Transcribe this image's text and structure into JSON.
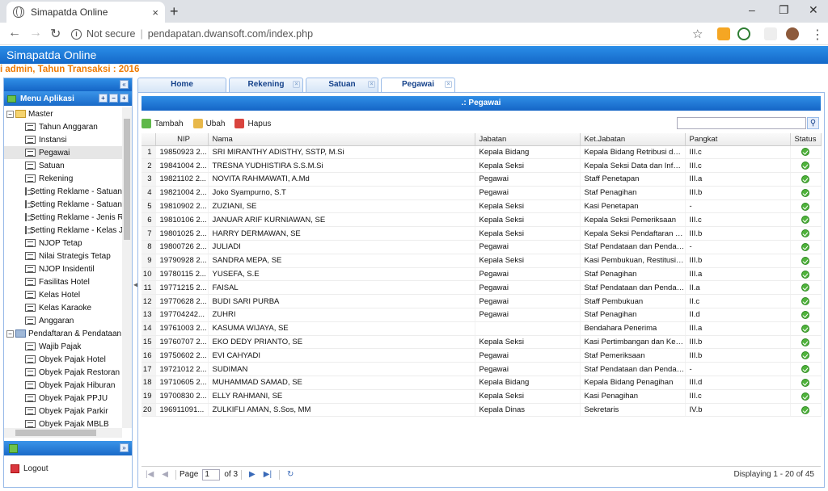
{
  "browser": {
    "tab_title": "Simapatda Online",
    "close_glyph": "×",
    "new_tab_glyph": "+",
    "omnibox_status": "Not secure",
    "omnibox_sep": "|",
    "url": "pendapatan.dwansoft.com/index.php",
    "star_glyph": "☆",
    "menu_glyph": "⋮"
  },
  "app": {
    "title": "Simapatda Online",
    "user_line": "i admin, Tahun Transaksi : 2016"
  },
  "sidebar": {
    "header": "Menu Aplikasi",
    "groups": [
      {
        "label": "Master"
      },
      {
        "label": "Pendaftaran & Pendataan"
      }
    ],
    "master_items": [
      "Tahun Anggaran",
      "Instansi",
      "Pegawai",
      "Satuan",
      "Rekening",
      "Setting Reklame - Satuan L",
      "Setting Reklame - Satuan T",
      "Setting Reklame - Jenis Re",
      "Setting Reklame - Kelas Ja",
      "NJOP Tetap",
      "Nilai Strategis Tetap",
      "NJOP Insidentil",
      "Fasilitas Hotel",
      "Kelas Hotel",
      "Kelas Karaoke",
      "Anggaran"
    ],
    "pendaftaran_items": [
      "Wajib Pajak",
      "Obyek Pajak Hotel",
      "Obyek Pajak Restoran",
      "Obyek Pajak Hiburan",
      "Obyek Pajak PPJU",
      "Obyek Pajak Parkir",
      "Obyek Pajak MBLB"
    ],
    "logout": "Logout"
  },
  "tabs": [
    "Home",
    "Rekening",
    "Satuan",
    "Pegawai"
  ],
  "grid": {
    "title": ".: Pegawai",
    "toolbar": {
      "add": "Tambah",
      "edit": "Ubah",
      "delete": "Hapus"
    },
    "columns": [
      "NIP",
      "Nama",
      "Jabatan",
      "Ket.Jabatan",
      "Pangkat",
      "Status"
    ],
    "rows": [
      [
        "1",
        "19850923 2...",
        "SRI MIRANTHY ADISTHY, SSTP, M.Si",
        "Kepala Bidang",
        "Kepala Bidang Retribusi dan ...",
        "III.c"
      ],
      [
        "2",
        "19841004 2...",
        "TRESNA YUDHISTIRA S.S.M.Si",
        "Kepala Seksi",
        "Kepala Seksi Data dan Infor...",
        "III.c"
      ],
      [
        "3",
        "19821102 2...",
        "NOVITA RAHMAWATI, A.Md",
        "Pegawai",
        "Staff Penetapan",
        "III.a"
      ],
      [
        "4",
        "19821004 2...",
        "Joko Syampurno, S.T",
        "Pegawai",
        "Staf Penagihan",
        "III.b"
      ],
      [
        "5",
        "19810902 2...",
        "ZUZIANI, SE",
        "Kepala Seksi",
        "Kasi Penetapan",
        "-"
      ],
      [
        "6",
        "19810106 2...",
        "JANUAR ARIF KURNIAWAN, SE",
        "Kepala Seksi",
        "Kepala Seksi Pemeriksaan",
        "III.c"
      ],
      [
        "7",
        "19801025 2...",
        "HARRY DERMAWAN, SE",
        "Kepala Seksi",
        "Kepala Seksi Pendaftaran da...",
        "III.b"
      ],
      [
        "8",
        "19800726 2...",
        "JULIADI",
        "Pegawai",
        "Staf Pendataan dan Pendaft...",
        "-"
      ],
      [
        "9",
        "19790928 2...",
        "SANDRA MEPA, SE",
        "Kepala Seksi",
        "Kasi Pembukuan, Restitusi, V...",
        "III.b"
      ],
      [
        "10",
        "19780115 2...",
        "YUSEFA, S.E",
        "Pegawai",
        "Staf Penagihan",
        "III.a"
      ],
      [
        "11",
        "19771215 2...",
        "FAISAL",
        "Pegawai",
        "Staf Pendataan dan Pendaft...",
        "II.a"
      ],
      [
        "12",
        "19770628 2...",
        "BUDI SARI PURBA",
        "Pegawai",
        "Staff Pembukuan",
        "II.c"
      ],
      [
        "13",
        "197704242...",
        "ZUHRI",
        "Pegawai",
        "Staf Penagihan",
        "II.d"
      ],
      [
        "14",
        "19761003 2...",
        "KASUMA WIJAYA, SE",
        "",
        "Bendahara Penerima",
        "III.a"
      ],
      [
        "15",
        "19760707 2...",
        "EKO DEDY PRIANTO, SE",
        "Kepala Seksi",
        "Kasi Pertimbangan dan Kebe...",
        "III.b"
      ],
      [
        "16",
        "19750602 2...",
        "EVI CAHYADI",
        "Pegawai",
        "Staf Pemeriksaan",
        "III.b"
      ],
      [
        "17",
        "19721012 2...",
        "SUDIMAN",
        "Pegawai",
        "Staf Pendataan dan Pendaft...",
        "-"
      ],
      [
        "18",
        "19710605 2...",
        "MUHAMMAD SAMAD, SE",
        "Kepala Bidang",
        "Kepala Bidang Penagihan",
        "III.d"
      ],
      [
        "19",
        "19700830 2...",
        "ELLY RAHMANI, SE",
        "Kepala Seksi",
        "Kasi Penagihan",
        "III.c"
      ],
      [
        "20",
        "196911091...",
        "ZULKIFLI AMAN, S.Sos, MM",
        "Kepala Dinas",
        "Sekretaris",
        "IV.b"
      ]
    ],
    "pager": {
      "page_label": "Page",
      "page_value": "1",
      "of_label": "of 3",
      "display": "Displaying 1 - 20 of 45"
    }
  }
}
